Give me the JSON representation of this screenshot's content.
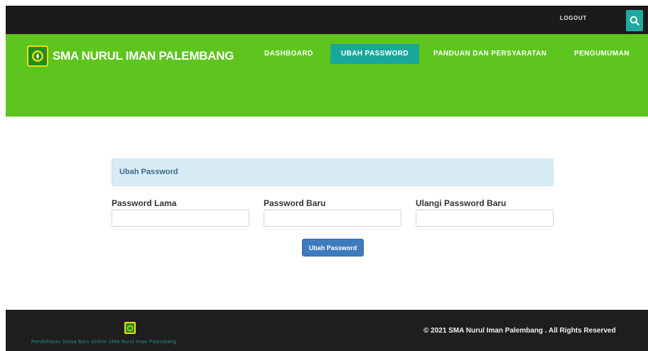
{
  "topbar": {
    "logout_label": "LOGOUT",
    "search_icon": "search-icon"
  },
  "header": {
    "brand": "SMA NURUL IMAN PALEMBANG",
    "logo_icon": "school-emblem-icon",
    "nav": [
      {
        "label": "DASHBOARD",
        "active": false
      },
      {
        "label": "UBAH PASSWORD",
        "active": true
      },
      {
        "label": "PANDUAN DAN PERSYARATAN",
        "active": false
      },
      {
        "label": "PENGUMUMAN",
        "active": false
      }
    ]
  },
  "form": {
    "heading": "Ubah Password",
    "fields": [
      {
        "label": "Password Lama",
        "value": ""
      },
      {
        "label": "Password Baru",
        "value": ""
      },
      {
        "label": "Ulangi Password Baru",
        "value": ""
      }
    ],
    "submit_label": "Ubah Password"
  },
  "footer": {
    "tagline": "Pendaftaran Siswa Baru Online SMA Nurul Iman Palembang",
    "copyright": "© 2021 SMA Nurul Iman Palembang . All Rights Reserved"
  },
  "colors": {
    "topbar": "#1b1b1b",
    "header_green": "#5dc51d",
    "accent_teal": "#1aa79a",
    "panel_bg": "#d8ecf6",
    "button_blue": "#3d7bbd",
    "footer": "#1e1e1e"
  }
}
